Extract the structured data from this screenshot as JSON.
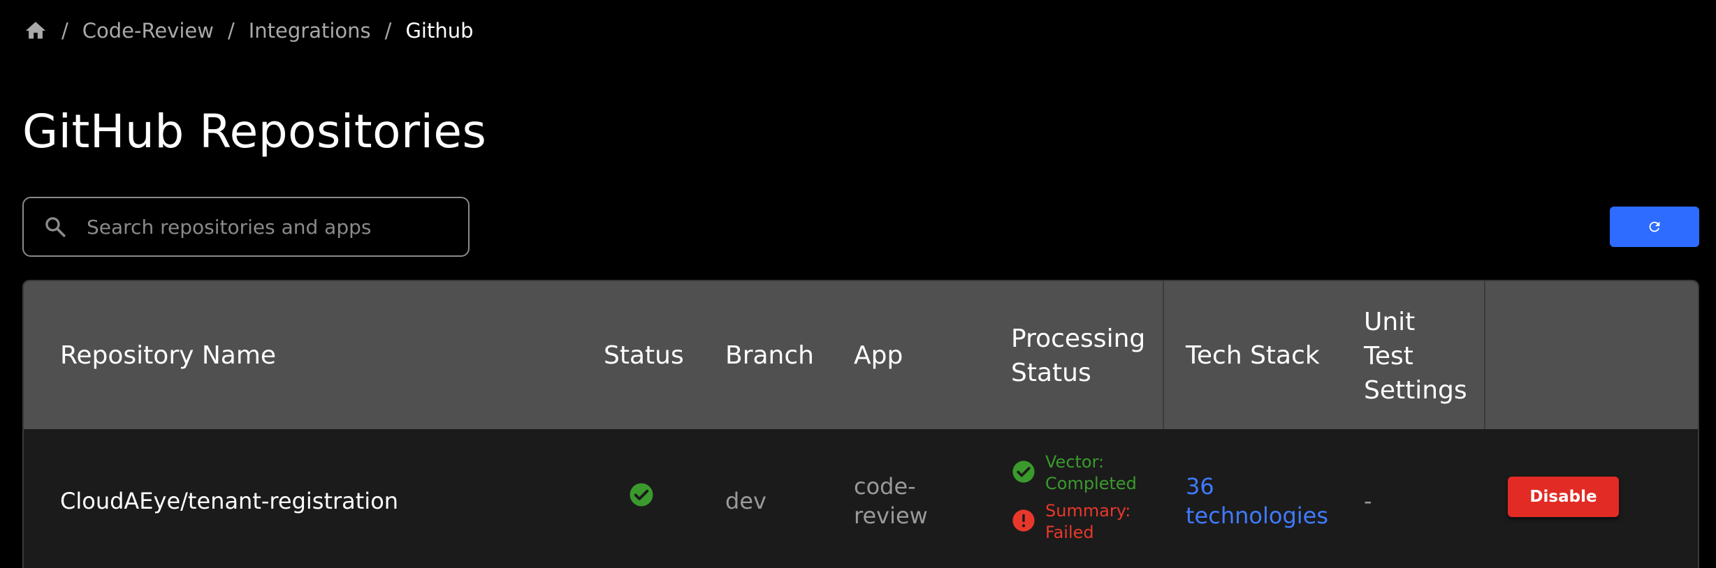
{
  "breadcrumb": {
    "items": [
      "Code-Review",
      "Integrations",
      "Github"
    ],
    "separator": "/"
  },
  "page": {
    "title": "GitHub Repositories"
  },
  "search": {
    "placeholder": "Search repositories and apps",
    "value": ""
  },
  "icons": {
    "home": "home-icon",
    "search": "search-icon",
    "refresh": "refresh-icon",
    "status_ok": "check-circle-icon",
    "status_error": "error-circle-icon"
  },
  "colors": {
    "accent": "#2e6bff",
    "success": "#3a9a2d",
    "danger": "#e12b24",
    "link": "#3f7bff",
    "header_bg": "#505050",
    "row_bg": "#1b1b1b"
  },
  "table": {
    "headers": {
      "repo_name": "Repository Name",
      "status": "Status",
      "branch": "Branch",
      "app": "App",
      "processing_status_line1": "Processing",
      "processing_status_line2": "Status",
      "tech_stack": "Tech Stack",
      "unit_test_line1": "Unit",
      "unit_test_line2": "Test",
      "unit_test_line3": "Settings"
    },
    "rows": [
      {
        "repo_name": "CloudAEye/tenant-registration",
        "status": "enabled",
        "branch": "dev",
        "app_line1": "code-",
        "app_line2": "review",
        "vector_line1": "Vector:",
        "vector_line2": "Completed",
        "summary_line1": "Summary:",
        "summary_line2": "Failed",
        "tech_line1": "36",
        "tech_line2": "technologies",
        "unit_test": "-",
        "action_label": "Disable"
      }
    ]
  }
}
